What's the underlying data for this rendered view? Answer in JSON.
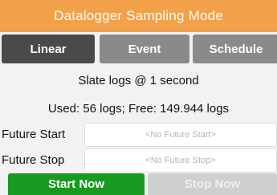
{
  "header": {
    "title": "Datalogger Sampling Mode",
    "color": "#f3a04a"
  },
  "tabs": [
    {
      "label": "Linear",
      "active": true
    },
    {
      "label": "Event",
      "active": false
    },
    {
      "label": "Schedule",
      "active": false
    }
  ],
  "status": {
    "mode_text": "Slate logs @ 1 second",
    "usage_text": "Used: 56 logs; Free: 149.944 logs"
  },
  "future": {
    "start_label": "Future Start",
    "start_placeholder": "<No Future Start>",
    "stop_label": "Future Stop",
    "stop_placeholder": "<No Future Stop>"
  },
  "actions": {
    "start_label": "Start Now",
    "start_color": "#179a1f",
    "stop_label": "Stop Now",
    "stop_enabled": false
  }
}
